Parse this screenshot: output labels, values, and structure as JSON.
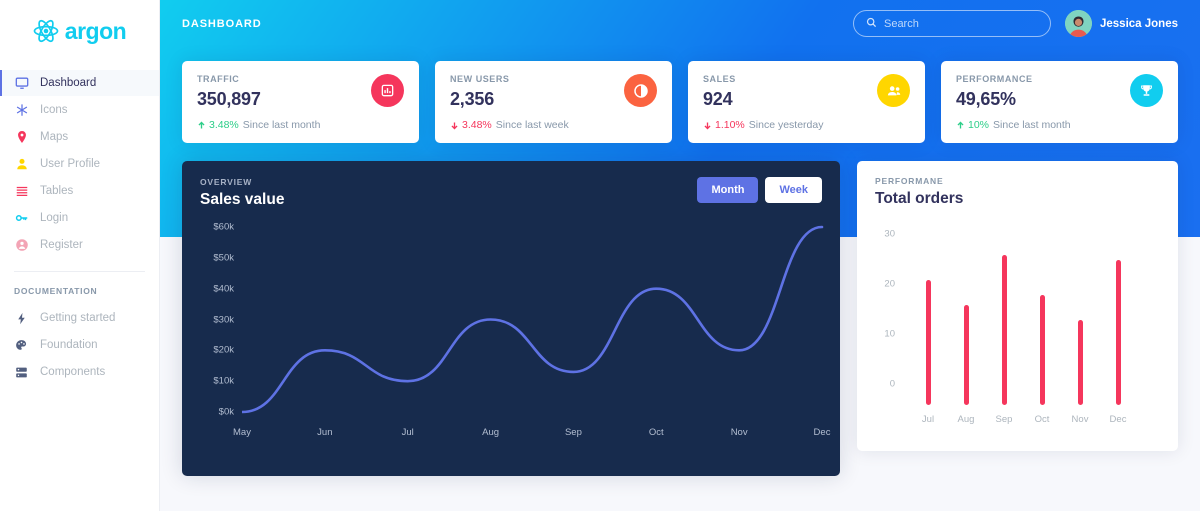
{
  "brand": {
    "name": "argon",
    "logo_icon": "react-atom-icon"
  },
  "sidebar": {
    "items": [
      {
        "label": "Dashboard",
        "icon": "monitor-icon",
        "active": true
      },
      {
        "label": "Icons",
        "icon": "snowflake-icon",
        "active": false
      },
      {
        "label": "Maps",
        "icon": "map-pin-icon",
        "active": false
      },
      {
        "label": "User Profile",
        "icon": "user-icon",
        "active": false
      },
      {
        "label": "Tables",
        "icon": "list-icon",
        "active": false
      },
      {
        "label": "Login",
        "icon": "key-icon",
        "active": false
      },
      {
        "label": "Register",
        "icon": "account-circle-icon",
        "active": false
      }
    ],
    "section_title": "DOCUMENTATION",
    "doc_items": [
      {
        "label": "Getting started",
        "icon": "lightning-icon"
      },
      {
        "label": "Foundation",
        "icon": "palette-icon"
      },
      {
        "label": "Components",
        "icon": "components-icon"
      }
    ]
  },
  "header": {
    "title": "DASHBOARD",
    "search": {
      "placeholder": "Search",
      "value": "",
      "icon": "search-icon"
    },
    "user": {
      "name": "Jessica Jones",
      "avatar": "user-avatar"
    }
  },
  "stats": [
    {
      "label": "TRAFFIC",
      "value": "350,897",
      "delta": "3.48%",
      "delta_dir": "up",
      "delta_color": "#2dce89",
      "note": "Since last month",
      "icon": "bar-chart-icon",
      "icon_bg": "#f5365c"
    },
    {
      "label": "NEW USERS",
      "value": "2,356",
      "delta": "3.48%",
      "delta_dir": "down",
      "delta_color": "#f5365c",
      "note": "Since last week",
      "icon": "pie-chart-icon",
      "icon_bg": "#fb6340"
    },
    {
      "label": "SALES",
      "value": "924",
      "delta": "1.10%",
      "delta_dir": "down",
      "delta_color": "#f5365c",
      "note": "Since yesterday",
      "icon": "users-icon",
      "icon_bg": "#ffd600"
    },
    {
      "label": "PERFORMANCE",
      "value": "49,65%",
      "delta": "10%",
      "delta_dir": "up",
      "delta_color": "#2dce89",
      "note": "Since last month",
      "icon": "trophy-icon",
      "icon_bg": "#11cdef"
    }
  ],
  "sales_chart": {
    "eyebrow": "OVERVIEW",
    "title": "Sales value",
    "toggle": {
      "month": "Month",
      "week": "Week",
      "active": "Month"
    }
  },
  "orders_chart": {
    "eyebrow": "PERFORMANE",
    "title": "Total orders"
  },
  "chart_data": [
    {
      "type": "line",
      "title": "Sales value",
      "subtitle": "OVERVIEW",
      "x": [
        "May",
        "Jun",
        "Jul",
        "Aug",
        "Sep",
        "Oct",
        "Nov",
        "Dec"
      ],
      "categories": [
        "May",
        "Jun",
        "Jul",
        "Aug",
        "Sep",
        "Oct",
        "Nov",
        "Dec"
      ],
      "values": [
        0,
        20,
        10,
        30,
        13,
        40,
        20,
        60
      ],
      "ytick_labels": [
        "$0k",
        "$10k",
        "$20k",
        "$30k",
        "$40k",
        "$50k",
        "$60k"
      ],
      "ytick_values": [
        0,
        10,
        20,
        30,
        40,
        50,
        60
      ],
      "ylim": [
        0,
        60
      ],
      "xlabel": "",
      "ylabel": "",
      "line_color": "#5e72e4",
      "grid": false,
      "legend": false,
      "smoothing": "spline"
    },
    {
      "type": "bar",
      "title": "Total orders",
      "subtitle": "PERFORMANE",
      "categories": [
        "Jul",
        "Aug",
        "Sep",
        "Oct",
        "Nov",
        "Dec"
      ],
      "values": [
        25,
        20,
        30,
        22,
        17,
        29
      ],
      "ytick_labels": [
        "0",
        "10",
        "20",
        "30"
      ],
      "ytick_values": [
        0,
        10,
        20,
        30
      ],
      "ylim": [
        0,
        30
      ],
      "xlabel": "",
      "ylabel": "",
      "bar_color": "#f5365c",
      "grid": false,
      "legend": false
    }
  ]
}
